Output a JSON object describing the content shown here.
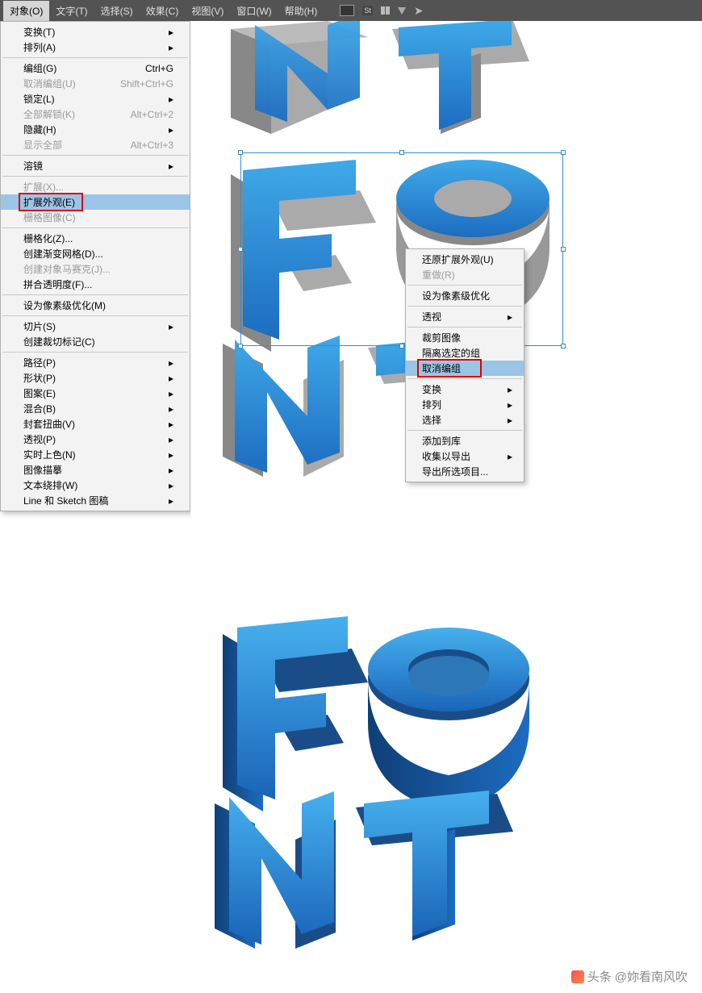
{
  "menubar": {
    "items": [
      {
        "label": "对象(O)",
        "open": true
      },
      {
        "label": "文字(T)"
      },
      {
        "label": "选择(S)"
      },
      {
        "label": "效果(C)"
      },
      {
        "label": "视图(V)"
      },
      {
        "label": "窗口(W)"
      },
      {
        "label": "帮助(H)"
      }
    ]
  },
  "dropdown": [
    {
      "label": "变换(T)",
      "submenu": true
    },
    {
      "label": "排列(A)",
      "submenu": true
    },
    {
      "sep": true
    },
    {
      "label": "编组(G)",
      "shortcut": "Ctrl+G"
    },
    {
      "label": "取消编组(U)",
      "shortcut": "Shift+Ctrl+G",
      "disabled": true
    },
    {
      "label": "锁定(L)",
      "submenu": true
    },
    {
      "label": "全部解锁(K)",
      "shortcut": "Alt+Ctrl+2",
      "disabled": true
    },
    {
      "label": "隐藏(H)",
      "submenu": true
    },
    {
      "label": "显示全部",
      "shortcut": "Alt+Ctrl+3",
      "disabled": true
    },
    {
      "sep": true
    },
    {
      "label": "溶镜",
      "submenu": true
    },
    {
      "sep": true
    },
    {
      "label": "扩展(X)...",
      "disabled": true
    },
    {
      "label": "扩展外观(E)",
      "highlight": true,
      "redbox": true
    },
    {
      "label": "栅格图像(C)",
      "disabled": true
    },
    {
      "sep": true
    },
    {
      "label": "栅格化(Z)..."
    },
    {
      "label": "创建渐变网格(D)..."
    },
    {
      "label": "创建对象马赛克(J)...",
      "disabled": true
    },
    {
      "label": "拼合透明度(F)..."
    },
    {
      "sep": true
    },
    {
      "label": "设为像素级优化(M)"
    },
    {
      "sep": true
    },
    {
      "label": "切片(S)",
      "submenu": true
    },
    {
      "label": "创建裁切标记(C)"
    },
    {
      "sep": true
    },
    {
      "label": "路径(P)",
      "submenu": true
    },
    {
      "label": "形状(P)",
      "submenu": true
    },
    {
      "label": "图案(E)",
      "submenu": true
    },
    {
      "label": "混合(B)",
      "submenu": true
    },
    {
      "label": "封套扭曲(V)",
      "submenu": true
    },
    {
      "label": "透视(P)",
      "submenu": true
    },
    {
      "label": "实时上色(N)",
      "submenu": true
    },
    {
      "label": "图像描摹",
      "submenu": true
    },
    {
      "label": "文本绕排(W)",
      "submenu": true
    },
    {
      "label": "Line 和 Sketch 图稿",
      "submenu": true
    }
  ],
  "context_menu": [
    {
      "label": "还原扩展外观(U)"
    },
    {
      "label": "重做(R)",
      "disabled": true
    },
    {
      "sep": true
    },
    {
      "label": "设为像素级优化"
    },
    {
      "sep": true
    },
    {
      "label": "透视",
      "submenu": true
    },
    {
      "sep": true
    },
    {
      "label": "裁剪图像"
    },
    {
      "label": "隔离选定的组"
    },
    {
      "label": "取消编组",
      "highlight": true,
      "redbox": true
    },
    {
      "sep": true
    },
    {
      "label": "变换",
      "submenu": true
    },
    {
      "label": "排列",
      "submenu": true
    },
    {
      "label": "选择",
      "submenu": true
    },
    {
      "sep": true
    },
    {
      "label": "添加到库"
    },
    {
      "label": "收集以导出",
      "submenu": true
    },
    {
      "label": "导出所选项目..."
    }
  ],
  "watermark": {
    "prefix": "头条",
    "text": "@妳看南风吹"
  },
  "art": {
    "text": "FONT"
  }
}
